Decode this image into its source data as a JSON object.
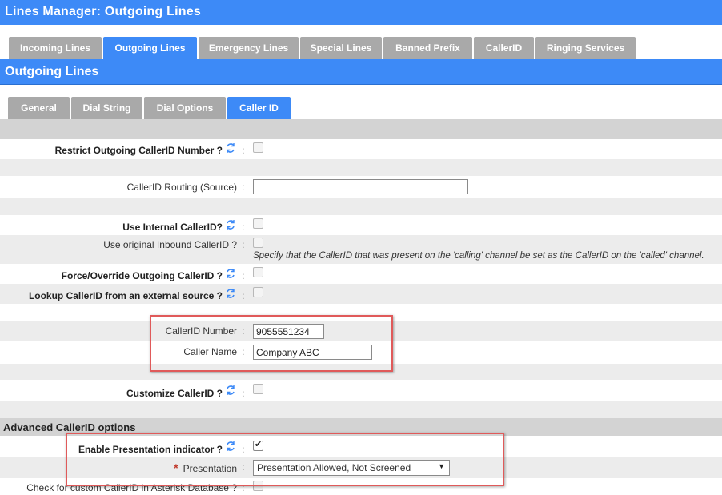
{
  "header": {
    "title": "Lines Manager:  Outgoing Lines"
  },
  "main_tabs": [
    {
      "label": "Incoming Lines"
    },
    {
      "label": "Outgoing Lines"
    },
    {
      "label": "Emergency Lines"
    },
    {
      "label": "Special Lines"
    },
    {
      "label": "Banned Prefix"
    },
    {
      "label": "CallerID"
    },
    {
      "label": "Ringing Services"
    }
  ],
  "section": {
    "title": "Outgoing Lines"
  },
  "sub_tabs": [
    {
      "label": "General"
    },
    {
      "label": "Dial String"
    },
    {
      "label": "Dial Options"
    },
    {
      "label": "Caller ID"
    }
  ],
  "form": {
    "restrict_outgoing": {
      "label": "Restrict Outgoing CallerID Number ?",
      "checked": false
    },
    "callerid_routing": {
      "label": "CallerID Routing (Source)",
      "value": ""
    },
    "use_internal": {
      "label": "Use Internal CallerID?",
      "checked": false
    },
    "use_original_inbound": {
      "label": "Use original Inbound CallerID ?",
      "checked": false,
      "hint": "Specify that the CallerID that was present on the 'calling' channel be set as the CallerID on the 'called' channel."
    },
    "force_override": {
      "label": "Force/Override Outgoing CallerID ?",
      "checked": false
    },
    "lookup_external": {
      "label": "Lookup CallerID from an external source ?",
      "checked": false
    },
    "callerid_number": {
      "label": "CallerID Number",
      "value": "9055551234"
    },
    "caller_name": {
      "label": "Caller Name",
      "value": "Company ABC"
    },
    "customize_callerid": {
      "label": "Customize CallerID ?",
      "checked": false
    },
    "advanced_title": "Advanced CallerID options",
    "enable_presentation": {
      "label": "Enable Presentation indicator ?",
      "checked": true
    },
    "presentation": {
      "required_mark": "*",
      "label": "Presentation",
      "value": "Presentation Allowed, Not Screened"
    },
    "check_custom": {
      "label": "Check for custom CallerID in Asterisk Database ?",
      "checked": false
    }
  },
  "colon": ":",
  "colors": {
    "accent": "#3d8af7",
    "tab_inactive": "#a9a9a9",
    "highlight": "#e05a5a"
  }
}
